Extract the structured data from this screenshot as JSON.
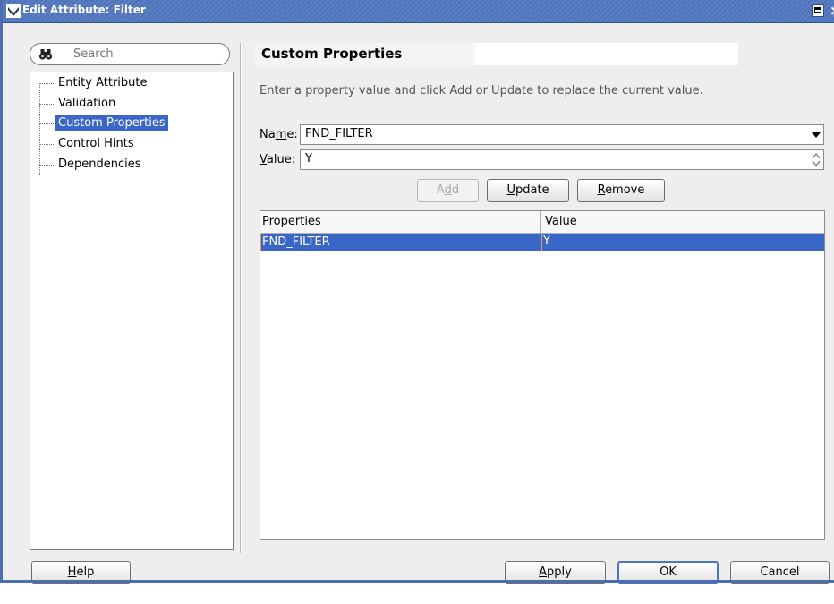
{
  "window": {
    "title": "Edit Attribute: Filter"
  },
  "search": {
    "placeholder": "Search"
  },
  "nav": {
    "items": [
      {
        "label": "Entity Attribute",
        "selected": false
      },
      {
        "label": "Validation",
        "selected": false
      },
      {
        "label": "Custom Properties",
        "selected": true
      },
      {
        "label": "Control Hints",
        "selected": false
      },
      {
        "label": "Dependencies",
        "selected": false
      }
    ]
  },
  "content": {
    "section_title": "Custom Properties",
    "instructions": "Enter a property value and click Add or Update to replace the current value.",
    "name_label_pre": "Na",
    "name_label_u": "m",
    "name_label_post": "e:",
    "name_value": "FND_FILTER",
    "value_label_u": "V",
    "value_label_post": "alue:",
    "value_value": "Y",
    "buttons": {
      "add": {
        "pre": "A",
        "u": "d",
        "post": "d",
        "enabled": false
      },
      "update": {
        "u": "U",
        "post": "pdate"
      },
      "remove": {
        "u": "R",
        "post": "emove"
      }
    },
    "table": {
      "columns": [
        "Properties",
        "Value"
      ],
      "rows": [
        {
          "property": "FND_FILTER",
          "value": "Y",
          "selected": true
        }
      ]
    }
  },
  "footer": {
    "help": {
      "u": "H",
      "post": "elp"
    },
    "apply": {
      "u": "A",
      "post": "pply"
    },
    "ok": "OK",
    "cancel": "Cancel"
  },
  "colors": {
    "titlebar": "#5c7fc4",
    "selection": "#3a66c8",
    "focus_outline": "#e0a040"
  },
  "icons": {
    "title_menu": "chevron-down-icon",
    "maximize": "maximize-icon",
    "close": "close-icon",
    "search": "binoculars-icon",
    "dropdown": "dropdown-arrow-icon",
    "spinner": "spinner-icon"
  }
}
